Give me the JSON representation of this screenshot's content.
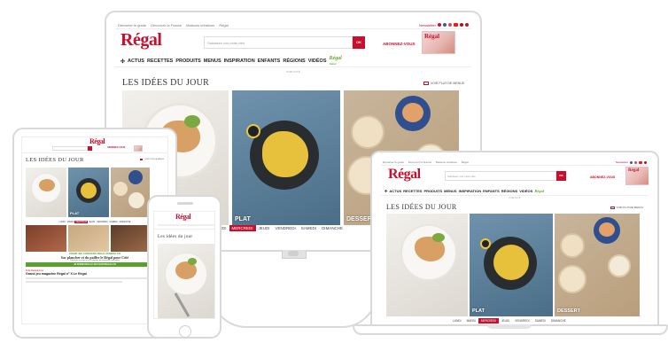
{
  "site": {
    "logo": "Régal",
    "mobile_logo": "Régal",
    "topbar_links": [
      "Démarrer le guide",
      "Découvrir la France",
      "Maisons créatives",
      "Régal"
    ],
    "newsletter": "Newsletter",
    "search_placeholder": "Saisissez vos mots clés",
    "ok_label": "OK",
    "subscribe_label": "ABONNEZ-VOUS",
    "magazine_label": "Régal",
    "nav_items": [
      "ACTUS",
      "RECETTES",
      "PRODUITS",
      "MENUS",
      "INSPIRATION",
      "ENFANTS",
      "RÉGIONS",
      "VIDÉOS"
    ],
    "nav_badge": "Régal",
    "nav_badge_sub": "Junior",
    "ad_label": "PUBLICITÉ",
    "section_title": "LES IDÉES DU JOUR",
    "more_menus": "VOIR PLUS DE MENUS",
    "mobile_section_title": "Les idées du jour",
    "categories": {
      "plat": "PLAT",
      "dessert": "DESSERT"
    },
    "days_monitor": [
      "MARDI",
      "MERCREDI",
      "JEUDI",
      "VENDREDI",
      "SAMEDI",
      "DIMANCHE"
    ],
    "days_monitor_active": "MERCREDI",
    "days_laptop": [
      "LUNDI",
      "MARDI",
      "MERCREDI",
      "JEUDI",
      "VENDREDI",
      "SAMEDI",
      "DIMANCHE"
    ],
    "days_laptop_active": "MERCREDI",
    "days_tablet": [
      "LUNDI",
      "MARDI",
      "MERCREDI",
      "JEUDI",
      "VENDREDI",
      "SAMEDI",
      "DIMANCHE"
    ],
    "days_tablet_active": "MERCREDI",
    "tablet_promo": {
      "title": "GRAND JEU CONCOURS RÉGAL NUMÉRO 100",
      "headline": "Sac plancher et du pailler le Régal pour Côté",
      "body": "Participez au concours et gagnez de nombreux trouvailles",
      "cta": "JE M'INSCRIS AU JEU SUR REGAL.FR"
    },
    "tablet_article_kicker": "Publi-Rédactionnel",
    "tablet_article_title": "Grand jeu magazine Régal nº X Le Régal"
  },
  "colors": {
    "brand_red": "#c8102e",
    "badge_green": "#6aa832",
    "cta_green": "#5aa02c"
  }
}
